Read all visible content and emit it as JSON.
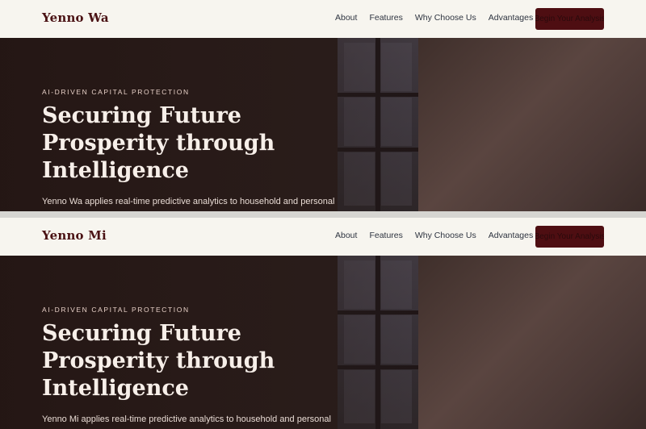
{
  "variants": [
    {
      "brand": "Yenno Wa",
      "nav": [
        "About",
        "Features",
        "Why Choose Us",
        "Advantages"
      ],
      "cta": "Begin Your Analysis",
      "eyebrow": "AI-DRIVEN CAPITAL PROTECTION",
      "headline": "Securing Future Prosperity through Intelligence",
      "body": "Yenno Wa applies real-time predictive analytics to household and personal"
    },
    {
      "brand": "Yenno Mi",
      "nav": [
        "About",
        "Features",
        "Why Choose Us",
        "Advantages"
      ],
      "cta": "Begin Your Analysis",
      "eyebrow": "AI-DRIVEN CAPITAL PROTECTION",
      "headline": "Securing Future Prosperity through Intelligence",
      "body": "Yenno Mi applies real-time predictive analytics to household and personal"
    }
  ],
  "colors": {
    "brand": "#4a1214",
    "cta_bg": "#4e0e12",
    "nav_bg": "#f7f5ef",
    "hero_text": "#f7efe9"
  }
}
